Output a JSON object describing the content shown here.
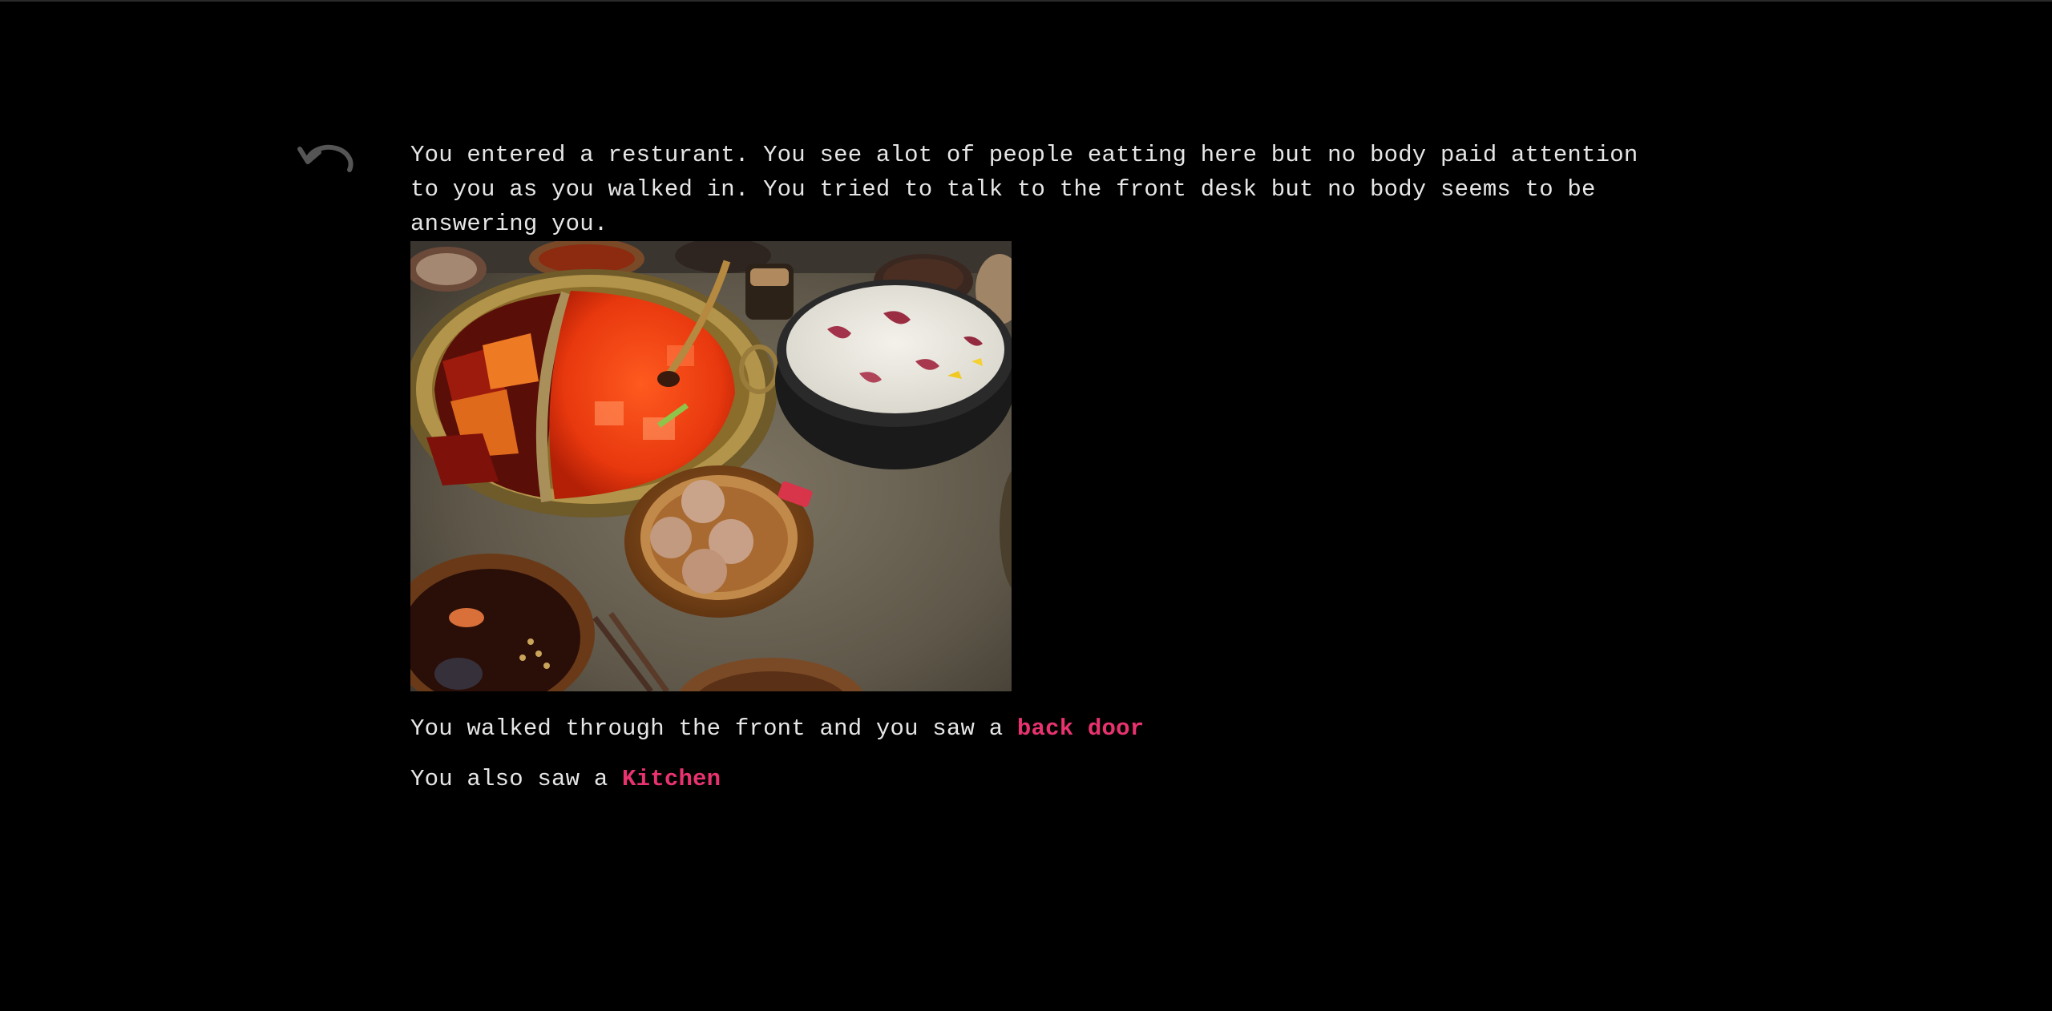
{
  "story": {
    "intro": "You entered a resturant. You see alot of people eatting here but no body paid attention to you as you walked in. You tried to talk to the front desk but no body seems to be answering you.",
    "line_back_prefix": "You walked through the front and you saw a ",
    "back_door_link": "back door",
    "line_kitchen_prefix": "You also saw a ",
    "kitchen_link": "Kitchen"
  },
  "icons": {
    "undo": "undo-arrow-icon"
  },
  "colors": {
    "background": "#000000",
    "text": "#e6e6e6",
    "link": "#e8336e",
    "undo_icon": "#555555"
  }
}
